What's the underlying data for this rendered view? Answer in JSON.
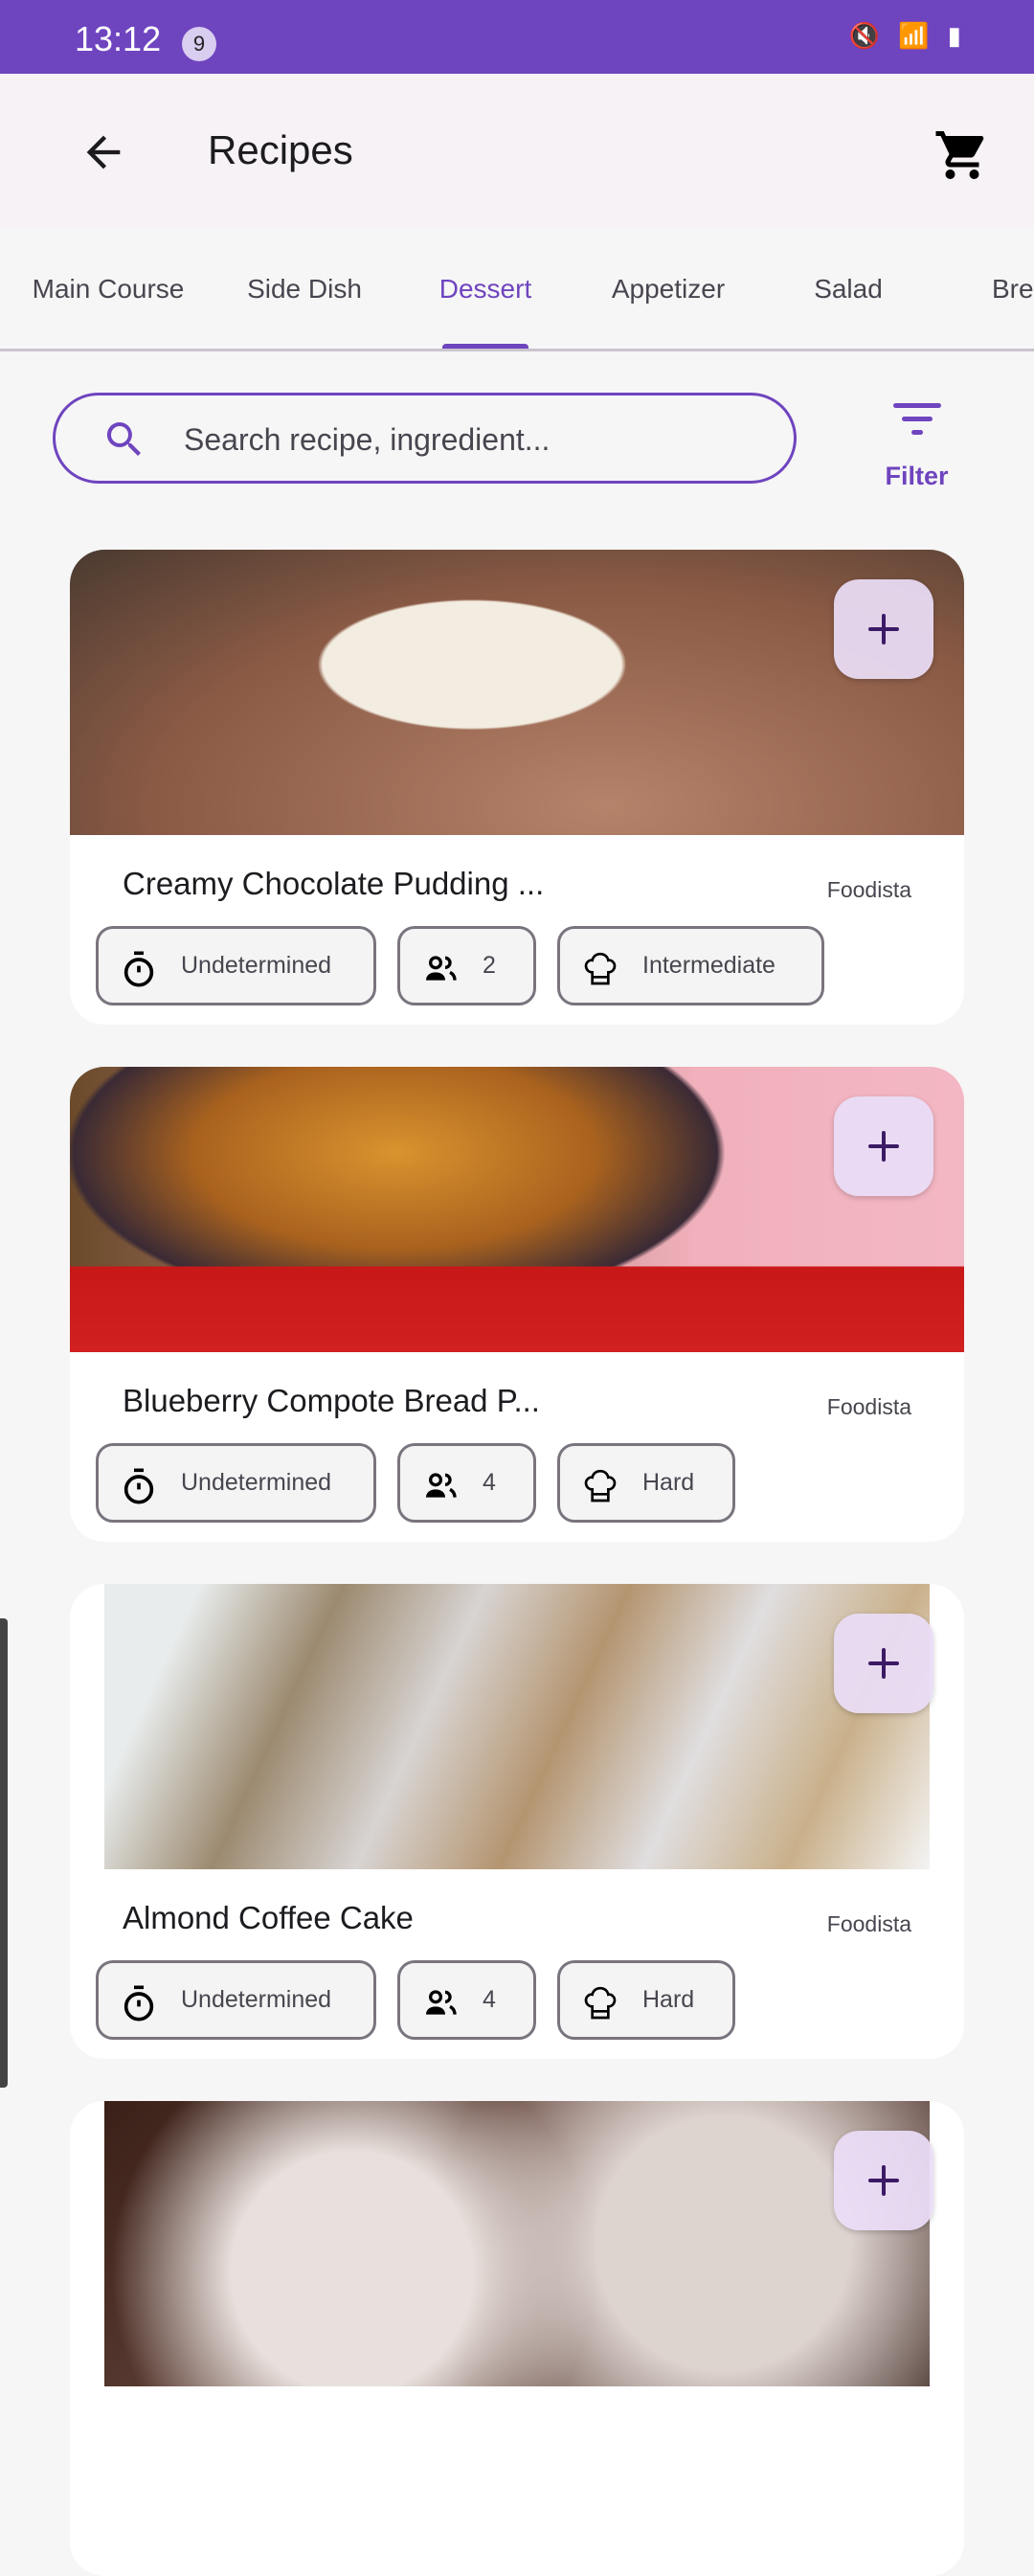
{
  "status_bar": {
    "time": "13:12",
    "notification_count": "9",
    "icons": [
      "mute-icon",
      "wifi-icon",
      "volte-icon",
      "signal-icon",
      "battery-icon"
    ],
    "battery": "7"
  },
  "app_bar": {
    "title": "Recipes",
    "back_icon": "arrow-back-icon",
    "cart_icon": "cart-icon"
  },
  "tabs": [
    {
      "label": "Main Course"
    },
    {
      "label": "Side Dish"
    },
    {
      "label": "Dessert",
      "active": true
    },
    {
      "label": "Appetizer"
    },
    {
      "label": "Salad"
    },
    {
      "label": "Bre"
    }
  ],
  "search": {
    "placeholder": "Search recipe, ingredient...",
    "value": ""
  },
  "filter": {
    "label": "Filter"
  },
  "colors": {
    "primary": "#6f44bf",
    "add_button": "#e9ddf6"
  },
  "recipes": [
    {
      "title": "Creamy Chocolate Pudding ...",
      "source": "Foodista",
      "time": "Undetermined",
      "servings": "2",
      "difficulty": "Intermediate"
    },
    {
      "title": "Blueberry Compote Bread P...",
      "source": "Foodista",
      "time": "Undetermined",
      "servings": "4",
      "difficulty": "Hard"
    },
    {
      "title": "Almond Coffee Cake",
      "source": "Foodista",
      "time": "Undetermined",
      "servings": "4",
      "difficulty": "Hard"
    },
    {
      "title": "",
      "source": "",
      "time": "",
      "servings": "",
      "difficulty": ""
    }
  ]
}
